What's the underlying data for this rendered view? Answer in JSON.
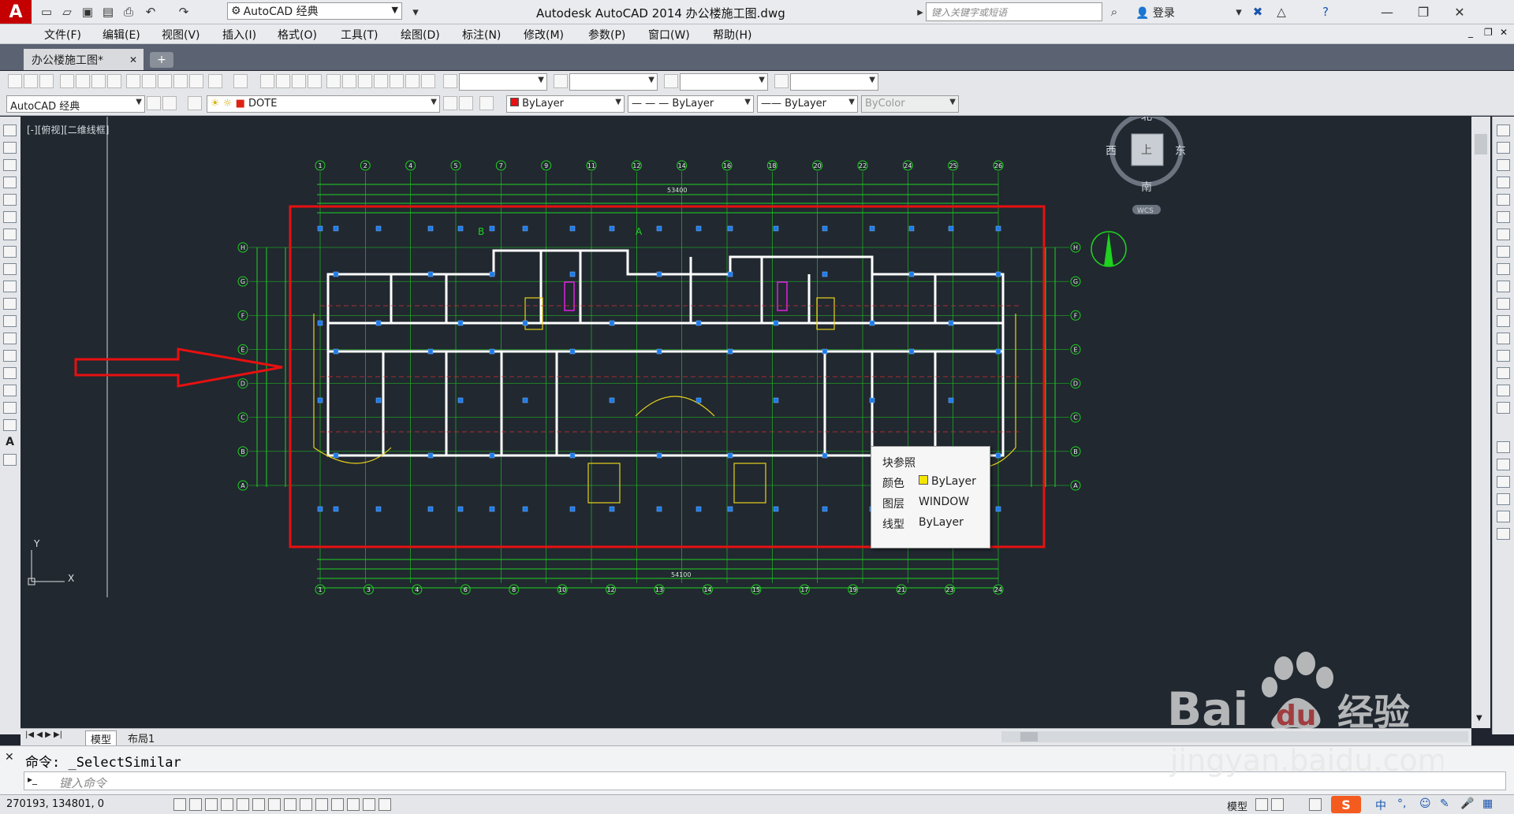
{
  "titlebar": {
    "workspace": "AutoCAD 经典",
    "title": "Autodesk AutoCAD 2014    办公楼施工图.dwg",
    "search_placeholder": "键入关键字或短语",
    "login": "登录"
  },
  "menu": [
    "文件(F)",
    "编辑(E)",
    "视图(V)",
    "插入(I)",
    "格式(O)",
    "工具(T)",
    "绘图(D)",
    "标注(N)",
    "修改(M)",
    "参数(P)",
    "窗口(W)",
    "帮助(H)"
  ],
  "doc_tab": "办公楼施工图*",
  "toolbar2": {
    "workspace": "AutoCAD 经典",
    "layer": "DOTE",
    "color": "ByLayer",
    "linetype": "ByLayer",
    "lineweight": "ByLayer",
    "plotstyle": "ByColor"
  },
  "view_label": "[-][俯视][二维线框]",
  "viewcube": {
    "north": "北",
    "south": "南",
    "east": "东",
    "west": "西",
    "top": "上",
    "wcs": "WCS"
  },
  "ucs": {
    "x": "X",
    "y": "Y"
  },
  "tooltip": {
    "title": "块参照",
    "rows": [
      {
        "label": "颜色",
        "value": "ByLayer"
      },
      {
        "label": "图层",
        "value": "WINDOW"
      },
      {
        "label": "线型",
        "value": "ByLayer"
      }
    ]
  },
  "plan": {
    "top_axes": [
      "1",
      "2",
      "4",
      "5",
      "7",
      "9",
      "11",
      "12",
      "14",
      "16",
      "18",
      "20",
      "22",
      "24",
      "25",
      "26"
    ],
    "bottom_axes": [
      "1",
      "3",
      "4",
      "6",
      "8",
      "10",
      "12",
      "13",
      "14",
      "15",
      "17",
      "19",
      "21",
      "23",
      "24"
    ],
    "side_axes": [
      "H",
      "G",
      "F",
      "E",
      "D",
      "C",
      "B",
      "A"
    ],
    "total_dim": "53400",
    "bottom_total": "54100",
    "section_marks": [
      "B",
      "A"
    ]
  },
  "layout_tabs": [
    "模型",
    "布局1"
  ],
  "command": {
    "prompt": "命令: _SelectSimilar",
    "placeholder": "键入命令"
  },
  "status": {
    "coords": "270193, 134801, 0",
    "model": "模型"
  },
  "watermark": {
    "brand": "Bai",
    "du": "du",
    "jy": "经验",
    "url": "jingyan.baidu.com"
  },
  "colors": {
    "annotation_red": "#e81010",
    "cad_green": "#1fd21f",
    "grip_blue": "#1e7be8"
  }
}
